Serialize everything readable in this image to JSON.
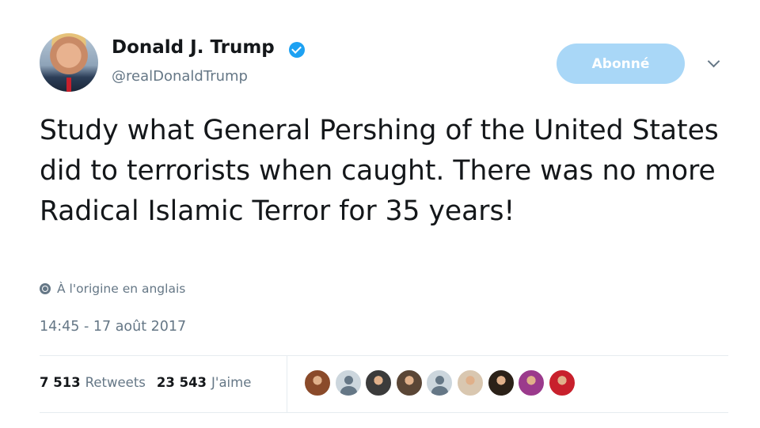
{
  "author": {
    "display_name": "Donald J. Trump",
    "handle": "@realDonaldTrump",
    "verified": true
  },
  "follow_button": {
    "label": "Abonné",
    "color": "#a9d7f7"
  },
  "tweet": {
    "text": "Study what General Pershing of the United States did to terrorists when caught. There was no more Radical Islamic Terror for 35 years!",
    "translation_note": "À l'origine en anglais",
    "timestamp": "14:45 - 17 août 2017"
  },
  "stats": {
    "retweets_count": "7 513",
    "retweets_label": "Retweets",
    "likes_count": "23 543",
    "likes_label": "J'aime"
  },
  "likers": [
    {
      "kind": "photo",
      "color": "#8a4a2a"
    },
    {
      "kind": "default",
      "color": "#ccd6dd"
    },
    {
      "kind": "photo",
      "color": "#3b3b3b"
    },
    {
      "kind": "photo",
      "color": "#5a4636"
    },
    {
      "kind": "default",
      "color": "#ccd6dd"
    },
    {
      "kind": "photo",
      "color": "#d9c7b0"
    },
    {
      "kind": "photo",
      "color": "#2b2118"
    },
    {
      "kind": "photo",
      "color": "#9b3a8c"
    },
    {
      "kind": "photo",
      "color": "#c8202c"
    }
  ],
  "colors": {
    "accent": "#1da1f2",
    "text": "#14171a",
    "muted": "#657786",
    "divider": "#e6ecf0"
  }
}
